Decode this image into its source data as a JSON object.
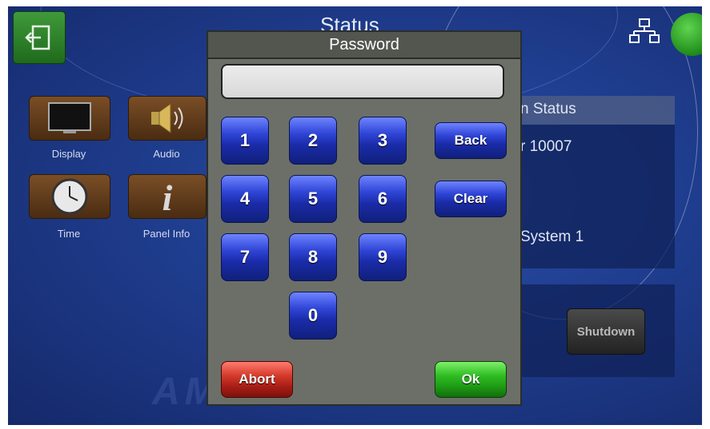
{
  "header": {
    "title": "Status"
  },
  "panel_icons": [
    {
      "label": "Display"
    },
    {
      "label": "Audio"
    },
    {
      "label": "Time"
    },
    {
      "label": "Panel Info"
    }
  ],
  "right_panel": {
    "heading": "n Status",
    "line1": "r 10007",
    "line2": "System  1"
  },
  "shutdown": {
    "label": "Shutdown"
  },
  "dialog": {
    "title": "Password",
    "password_value": "",
    "keys": [
      "1",
      "2",
      "3",
      "4",
      "5",
      "6",
      "7",
      "8",
      "9",
      "0"
    ],
    "back_label": "Back",
    "clear_label": "Clear",
    "abort_label": "Abort",
    "ok_label": "Ok"
  },
  "colors": {
    "background": "#1f3d8e",
    "key_blue": "#2f45d6",
    "abort_red": "#d23a2a",
    "ok_green": "#2ebc22",
    "status_green": "#1f8c1a",
    "dialog_gray": "#6c6f68"
  },
  "icons": {
    "exit": "exit-icon",
    "network": "network-icon",
    "status": "status-indicator-icon",
    "display": "monitor-icon",
    "audio": "speaker-icon",
    "time": "clock-icon",
    "panel_info": "info-icon"
  }
}
